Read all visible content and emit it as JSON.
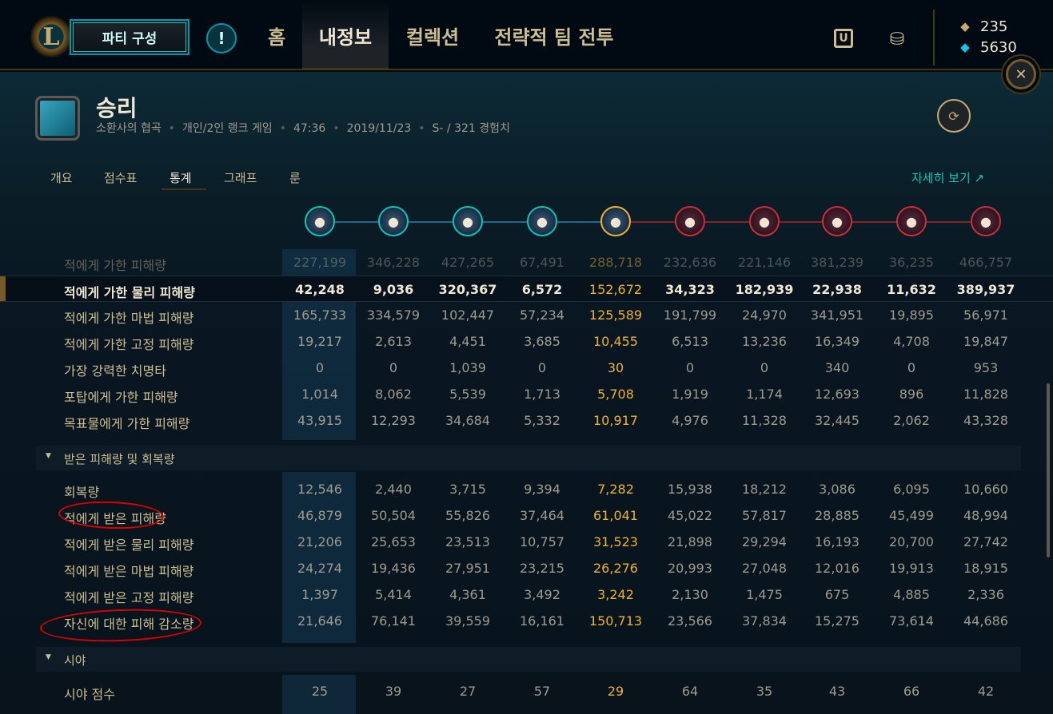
{
  "nav": {
    "logo_letter": "L",
    "party_button": "파티 구성",
    "alert_icon": "!",
    "items": [
      "홈",
      "내정보",
      "컬렉션",
      "전략적 팀 전투"
    ],
    "active_item": "내정보",
    "store_icon": "store-icon",
    "loot_icon": "loot-icon",
    "rp": "235",
    "be": "5630"
  },
  "match": {
    "result": "승리",
    "map": "소환사의 협곡",
    "queue": "개인/2인 랭크 게임",
    "duration": "47:36",
    "date": "2019/11/23",
    "grade_exp": "S- / 321 경험치"
  },
  "tabs": [
    "개요",
    "점수표",
    "통계",
    "그래프",
    "룬"
  ],
  "active_tab": "통계",
  "details_link": "자세히 보기 ↗",
  "champions": [
    {
      "team": "blue",
      "glyph": "●"
    },
    {
      "team": "blue",
      "glyph": "●"
    },
    {
      "team": "blue",
      "glyph": "●"
    },
    {
      "team": "blue",
      "glyph": "●"
    },
    {
      "team": "blue",
      "glyph": "●",
      "me": true
    },
    {
      "team": "red",
      "glyph": "●"
    },
    {
      "team": "red",
      "glyph": "●"
    },
    {
      "team": "red",
      "glyph": "●"
    },
    {
      "team": "red",
      "glyph": "●"
    },
    {
      "team": "red",
      "glyph": "●"
    }
  ],
  "damage_rows": [
    {
      "label": "적에게 가한 피해량",
      "values": [
        "227,199",
        "346,228",
        "427,265",
        "67,491",
        "288,718",
        "232,636",
        "221,146",
        "381,239",
        "36,235",
        "466,757"
      ],
      "faded": true
    },
    {
      "label": "적에게 가한 물리 피해량",
      "values": [
        "42,248",
        "9,036",
        "320,367",
        "6,572",
        "152,672",
        "34,323",
        "182,939",
        "22,938",
        "11,632",
        "389,937"
      ],
      "selected": true
    },
    {
      "label": "적에게 가한 마법 피해량",
      "values": [
        "165,733",
        "334,579",
        "102,447",
        "57,234",
        "125,589",
        "191,799",
        "24,970",
        "341,951",
        "19,895",
        "56,971"
      ]
    },
    {
      "label": "적에게 가한 고정 피해량",
      "values": [
        "19,217",
        "2,613",
        "4,451",
        "3,685",
        "10,455",
        "6,513",
        "13,236",
        "16,349",
        "4,708",
        "19,847"
      ]
    },
    {
      "label": "가장 강력한 치명타",
      "values": [
        "0",
        "0",
        "1,039",
        "0",
        "30",
        "0",
        "0",
        "340",
        "0",
        "953"
      ]
    },
    {
      "label": "포탑에게 가한 피해량",
      "values": [
        "1,014",
        "8,062",
        "5,539",
        "1,713",
        "5,708",
        "1,919",
        "1,174",
        "12,693",
        "896",
        "11,828"
      ]
    },
    {
      "label": "목표물에게 가한 피해량",
      "values": [
        "43,915",
        "12,293",
        "34,684",
        "5,332",
        "10,917",
        "4,976",
        "11,328",
        "32,445",
        "2,062",
        "43,328"
      ]
    }
  ],
  "section_taken": "받은 피해량 및 회복량",
  "taken_rows": [
    {
      "label": "회복량",
      "values": [
        "12,546",
        "2,440",
        "3,715",
        "9,394",
        "7,282",
        "15,938",
        "18,212",
        "3,086",
        "6,095",
        "10,660"
      ]
    },
    {
      "label": "적에게 받은 피해량",
      "values": [
        "46,879",
        "50,504",
        "55,826",
        "37,464",
        "61,041",
        "45,022",
        "57,817",
        "28,885",
        "45,499",
        "48,994"
      ]
    },
    {
      "label": "적에게 받은 물리 피해량",
      "values": [
        "21,206",
        "25,653",
        "23,513",
        "10,757",
        "31,523",
        "21,898",
        "29,294",
        "16,193",
        "20,700",
        "27,742"
      ]
    },
    {
      "label": "적에게 받은 마법 피해량",
      "values": [
        "24,274",
        "19,436",
        "27,951",
        "23,215",
        "26,276",
        "20,993",
        "27,048",
        "12,016",
        "19,913",
        "18,915"
      ]
    },
    {
      "label": "적에게 받은 고정 피해량",
      "values": [
        "1,397",
        "5,414",
        "4,361",
        "3,492",
        "3,242",
        "2,130",
        "1,475",
        "675",
        "4,885",
        "2,336"
      ]
    },
    {
      "label": "자신에 대한 피해 감소량",
      "values": [
        "21,646",
        "76,141",
        "39,559",
        "16,161",
        "150,713",
        "23,566",
        "37,834",
        "15,275",
        "73,614",
        "44,686"
      ]
    }
  ],
  "section_vision": "시야",
  "vision_rows": [
    {
      "label": "시야 점수",
      "values": [
        "25",
        "39",
        "27",
        "57",
        "29",
        "64",
        "35",
        "43",
        "66",
        "42"
      ]
    }
  ],
  "colors": {
    "accent_gold": "#c8aa6e",
    "me_highlight": "#f0b232",
    "teal": "#0ac8b9",
    "annotation": "#dd0000"
  }
}
